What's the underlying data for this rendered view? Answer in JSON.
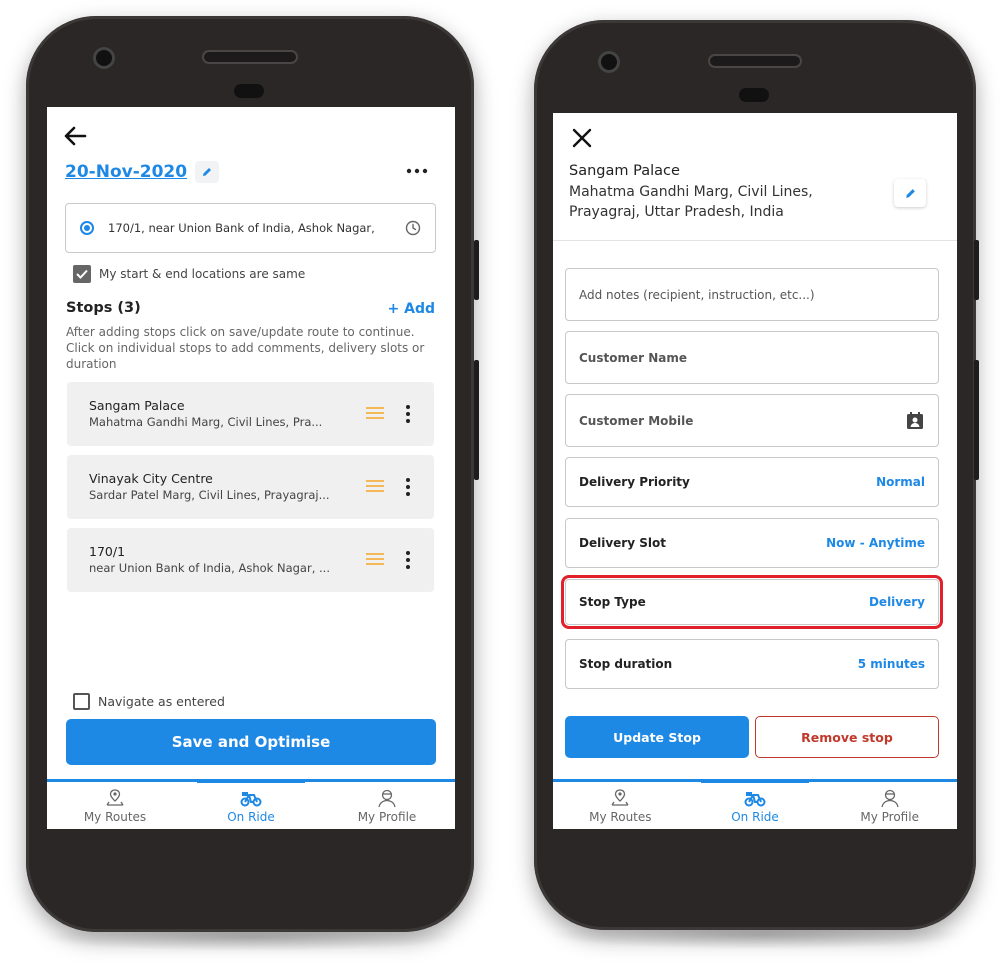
{
  "left_screen": {
    "date": "20-Nov-2020",
    "start_location": "170/1, near Union Bank of India, Ashok Nagar,",
    "same_locations_label": "My start & end locations are same",
    "stops_heading": "Stops (3)",
    "add_label": "+ Add",
    "stops_help": "After adding stops click on save/update route to continue. Click on individual stops to add comments, delivery slots or duration",
    "stops": [
      {
        "name": "Sangam Palace",
        "address": "Mahatma Gandhi Marg, Civil Lines, Pra..."
      },
      {
        "name": "Vinayak City Centre",
        "address": "Sardar Patel Marg, Civil Lines, Prayagraj..."
      },
      {
        "name": "170/1",
        "address": "near Union Bank of India, Ashok Nagar, ..."
      }
    ],
    "navigate_label": "Navigate as entered",
    "primary_button": "Save and Optimise"
  },
  "right_screen": {
    "place_title": "Sangam Palace",
    "place_address": "Mahatma Gandhi Marg, Civil Lines, Prayagraj, Uttar Pradesh, India",
    "notes_placeholder": "Add notes (recipient, instruction, etc...)",
    "customer_name_placeholder": "Customer Name",
    "customer_mobile_placeholder": "Customer Mobile",
    "rows": [
      {
        "label": "Delivery Priority",
        "value": "Normal"
      },
      {
        "label": "Delivery Slot",
        "value": "Now - Anytime"
      },
      {
        "label": "Stop Type",
        "value": "Delivery"
      },
      {
        "label": "Stop duration",
        "value": "5 minutes"
      }
    ],
    "update_button": "Update Stop",
    "remove_button": "Remove stop"
  },
  "bottom_nav": {
    "items": [
      {
        "label": "My Routes",
        "icon": "routes-icon"
      },
      {
        "label": "On Ride",
        "icon": "bike-icon"
      },
      {
        "label": "My Profile",
        "icon": "profile-icon"
      }
    ],
    "active": "On Ride"
  },
  "colors": {
    "accent": "#1e88e5",
    "highlight": "#e0202a",
    "danger": "#c0392b",
    "drag_handle": "#f5a623"
  }
}
